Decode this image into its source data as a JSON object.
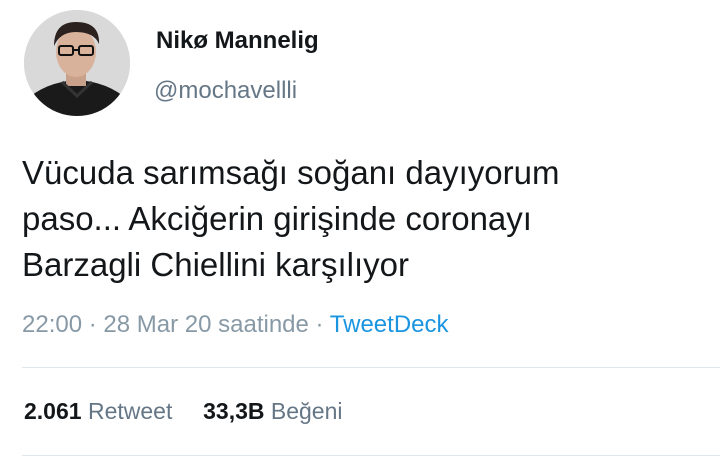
{
  "author": {
    "display_name": "Nikø Mannelig",
    "handle": "@mochavellli"
  },
  "tweet": {
    "lines": [
      "Vücuda sarımsağı soğanı dayıyorum",
      "paso... Akciğerin girişinde coronayı",
      "Barzagli Chiellini karşılıyor"
    ]
  },
  "meta": {
    "time": "22:00",
    "separator": "·",
    "date": "28 Mar 20 saatinde",
    "source": "TweetDeck"
  },
  "stats": {
    "retweets_count": "2.061",
    "retweets_label": "Retweet",
    "likes_count": "33,3B",
    "likes_label": "Beğeni"
  },
  "colors": {
    "text": "#14171a",
    "secondary": "#657786",
    "link": "#1b95e0",
    "divider": "#e1e8ed"
  }
}
